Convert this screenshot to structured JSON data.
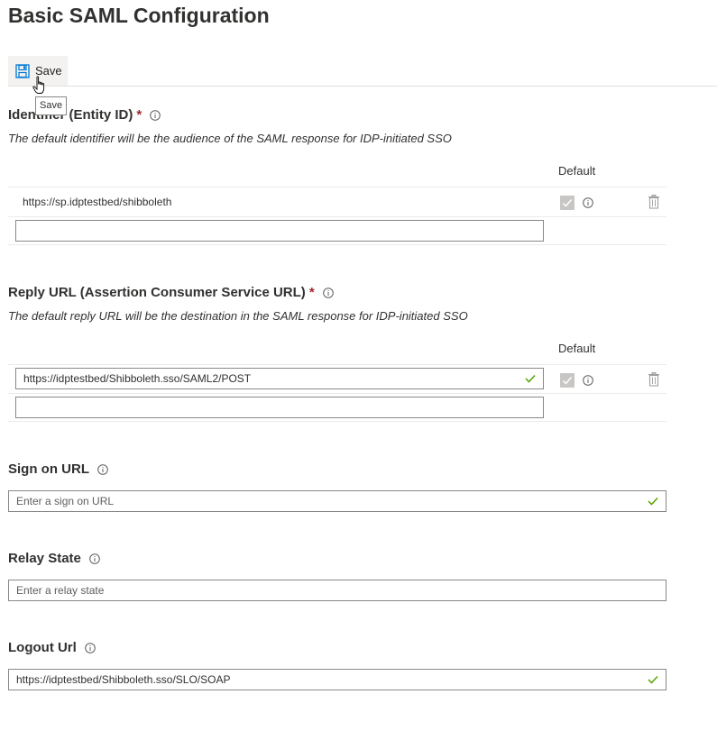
{
  "page": {
    "title": "Basic SAML Configuration"
  },
  "toolbar": {
    "save_label": "Save",
    "save_tooltip": "Save"
  },
  "identifier": {
    "label": "Identifier (Entity ID)",
    "required_mark": "*",
    "description": "The default identifier will be the audience of the SAML response for IDP-initiated SSO",
    "default_header": "Default",
    "rows": [
      {
        "value": "https://sp.idptestbed/shibboleth",
        "default": true
      }
    ],
    "new_value": ""
  },
  "reply_url": {
    "label": "Reply URL (Assertion Consumer Service URL)",
    "required_mark": "*",
    "description": "The default reply URL will be the destination in the SAML response for IDP-initiated SSO",
    "default_header": "Default",
    "rows": [
      {
        "value": "https://idptestbed/Shibboleth.sso/SAML2/POST",
        "default": true,
        "valid": true
      }
    ],
    "new_value": ""
  },
  "sign_on_url": {
    "label": "Sign on URL",
    "value": "",
    "placeholder": "Enter a sign on URL"
  },
  "relay_state": {
    "label": "Relay State",
    "value": "",
    "placeholder": "Enter a relay state"
  },
  "logout_url": {
    "label": "Logout Url",
    "value": "https://idptestbed/Shibboleth.sso/SLO/SOAP"
  },
  "colors": {
    "accent": "#0078d4",
    "required": "#a4262c",
    "valid": "#57a300",
    "border": "#8a8886"
  }
}
